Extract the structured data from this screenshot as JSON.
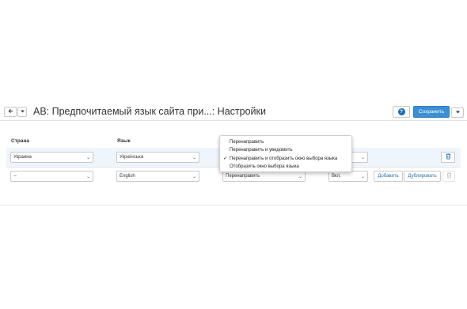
{
  "header": {
    "title": "AB: Предпочитаемый язык сайта при...: Настройки",
    "save_label": "Сохранить",
    "help_label": "?"
  },
  "columns": {
    "country": "Страна",
    "language": "Язык"
  },
  "rows": [
    {
      "country": "Украина",
      "language": "Українська",
      "status": ""
    },
    {
      "country": "--",
      "language": "English",
      "action": "Перенаправить",
      "status": "Вкл.",
      "add_label": "Добавить",
      "duplicate_label": "Дублировать"
    }
  ],
  "dropdown": {
    "options": [
      "Перенаправить",
      "Перенаправить и уведомить",
      "Перенаправить и отобразить окно выбора языка",
      "Отобразить окно выбора языка"
    ],
    "selected_index": 2
  },
  "colors": {
    "accent": "#3b8fd2",
    "row_highlight": "#eef5fb",
    "link": "#2a6fae"
  }
}
